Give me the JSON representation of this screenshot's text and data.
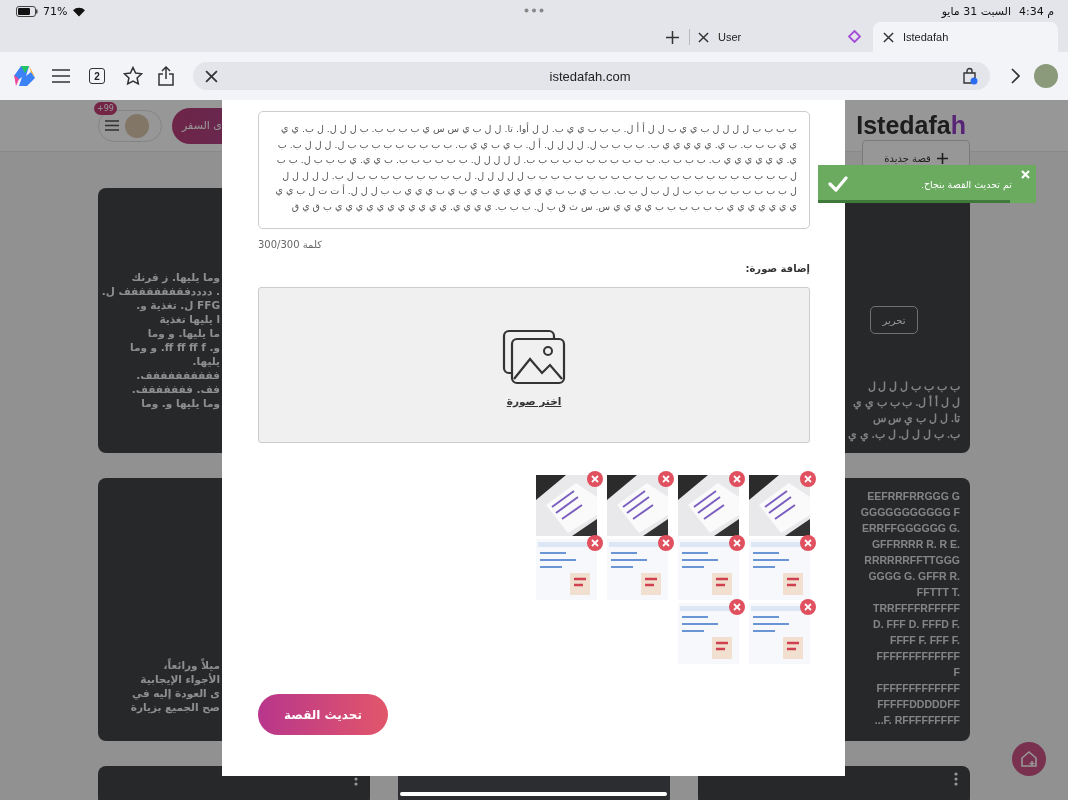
{
  "status_bar": {
    "battery": "71%",
    "date": "السبت 31 مايو",
    "time": "4:34 م"
  },
  "browser": {
    "tabs": [
      {
        "label": "Istedafah",
        "selected": true
      },
      {
        "label": "User",
        "selected": false
      }
    ],
    "tab_count": "2",
    "url": "istedafah.com"
  },
  "page": {
    "notification_badge": "+99",
    "travel_button": "ى السفر",
    "logo": "Istedafah",
    "new_story_button": "قصة جديدة",
    "left_cards": [
      {
        "lines": [
          "وما يليها. ز فرنك",
          ". ددددففففففففف ل.",
          "FFG ل. تغذية و.",
          "ا يليها تغذية",
          "ما يليها. و وما",
          "و. ff ff ff f. و وما",
          "يليها.",
          "فففففففففف.",
          "فف. ففففففف.",
          "وما يليها و. وما"
        ]
      },
      {
        "lines": [
          "ميلاً ورائعاً،",
          "الأجواء الإيجابية",
          "ى العودة إليه في",
          "صح الجميع بزيارة"
        ]
      }
    ],
    "right_cards": [
      {
        "button": "تحرير",
        "lines": [
          "ب ب ب ب ل ل ل ل",
          "ل ل أ أ ل. ب ب ب ي ي",
          "تا. ل ل ب ي س س",
          "ب. ب ل ل ل. ل ب. ي ي"
        ]
      },
      {
        "lines": [
          "EEFRRFRRGGG G",
          "GGGGGGGGGGG F",
          "ERRFFGGGGGG G.",
          "GFFRRRR R. R E.",
          "RRRRRRFFTTGGG",
          "GGGG G. GFFR R.",
          "FFTTT T.",
          "TRRFFFFRFFFFF",
          "D. FFF D. FFFD F.",
          "FFFF F. FFF F.",
          "FFFFFFFFFFFFF",
          "F",
          "FFFFFFFFFFFFF",
          "FFFFFDDDDDFF",
          "...F. RFFFFFFFFF"
        ]
      }
    ]
  },
  "modal": {
    "story_text": "ب ب ب ب ل ل ل ل ب ي ي ب ل ل أ أ ل. ب ب ب ي ي ب. ل ل أوا. تا. ل ل ب ي س س ي ب ب ب ب. ب ل ل ل. ل ب. ي ي ي ي ب ب ب. ب ي. ي ي ي ي ي ب. ب ب ب ب ل. ل ل ل ل. أ ل. ب ي ب ي ي ب. ب ب ب ب ب ب ب ب ب ل. ل ل ل ب. ب ي. ي ي ي ي ي ي ب. ب ب ب ب. ب ب ب ب ب ب ب ب ب ب ب. ل ل ل ل ل. ب ب ب ب ب ب. ب ي ي. ي ب ب ب ل. ب ب ل ب ب ب ب ب ب ب ب ب ب ب ب ب ب ب ب ب ب ب ب ب ب ل ل ل ل ل. ل ب ب ب ب ب ب ب ب ب ل ب. ل ل ل ل ل ل ب ب ب ب ب ب ب ب ب ل ل ب ل ب ب. ب ب ي ب ب ي ي ي ي ي ي ب ي ب ي ب ي ي ي ب ب ل ل ل. أ ت ت ل ب ي ي ي ي ي ي ي ي ي ب ب ب ب ب ب ي ي ي ي س. س ث ق ب ل. ب ب ب. ي ي ي ي. ي ي ي ي ي ي ي ي ي ي ي ب ق ي ق",
    "word_count": "300/300 كلمة",
    "image_label": "إضافة صورة:",
    "choose_image": "اختر صورة",
    "images": [
      {
        "kind": "photo"
      },
      {
        "kind": "photo"
      },
      {
        "kind": "photo"
      },
      {
        "kind": "photo"
      },
      {
        "kind": "document"
      },
      {
        "kind": "document"
      },
      {
        "kind": "document"
      },
      {
        "kind": "document"
      },
      {
        "kind": "document"
      },
      {
        "kind": "document"
      }
    ],
    "submit_button": "تحديث القصة"
  },
  "toast": {
    "message": "تم تحديث القصة بنجاح.",
    "level": 0.88
  }
}
